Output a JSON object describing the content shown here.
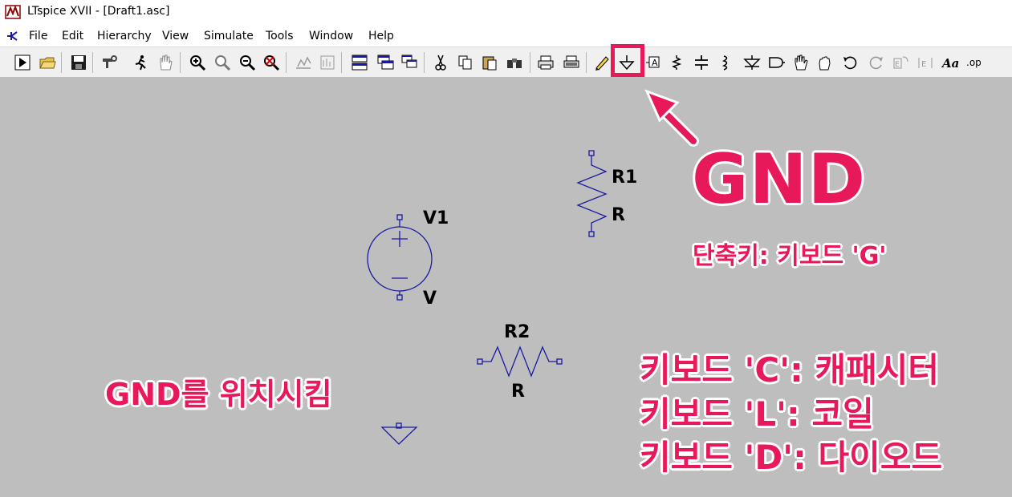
{
  "window": {
    "title": "LTspice XVII - [Draft1.asc]"
  },
  "menu": [
    "File",
    "Edit",
    "Hierarchy",
    "View",
    "Simulate",
    "Tools",
    "Window",
    "Help"
  ],
  "toolbar": {
    "buttons": [
      "run-icon",
      "open-icon",
      "save-icon",
      "control-panel-icon",
      "halt-icon",
      "pan-icon",
      "zoom-in-icon",
      "zoom-area-icon",
      "zoom-out-icon",
      "zoom-fit-icon",
      "autorange-icon",
      "view-measure-icon",
      "tile-horizontal-icon",
      "tile-vertical-icon",
      "cascade-icon",
      "cut-icon",
      "copy-icon",
      "paste-icon",
      "find-icon",
      "print-icon",
      "print-preview-icon",
      "draw-wire-icon",
      "ground-icon",
      "label-net-icon",
      "resistor-icon",
      "capacitor-icon",
      "inductor-icon",
      "diode-icon",
      "component-icon",
      "move-icon",
      "drag-icon",
      "undo-icon",
      "redo-icon",
      "rotate-icon",
      "mirror-icon",
      "text-icon",
      "spice-directive-icon"
    ]
  },
  "schematic": {
    "components": [
      {
        "ref": "R1",
        "value": "R"
      },
      {
        "ref": "V1",
        "value": "V"
      },
      {
        "ref": "R2",
        "value": "R"
      }
    ]
  },
  "annotations": {
    "gnd_title": "GND",
    "gnd_shortcut": "단축키: 키보드 'G'",
    "place_gnd": "GND를 위치시킴",
    "key_c": "키보드 'C': 캐패시터",
    "key_l": "키보드 'L': 코일",
    "key_d": "키보드 'D': 다이오드"
  },
  "colors": {
    "accent": "#e8195b",
    "canvas": "#bebebe",
    "wire": "#1a1aa0"
  }
}
